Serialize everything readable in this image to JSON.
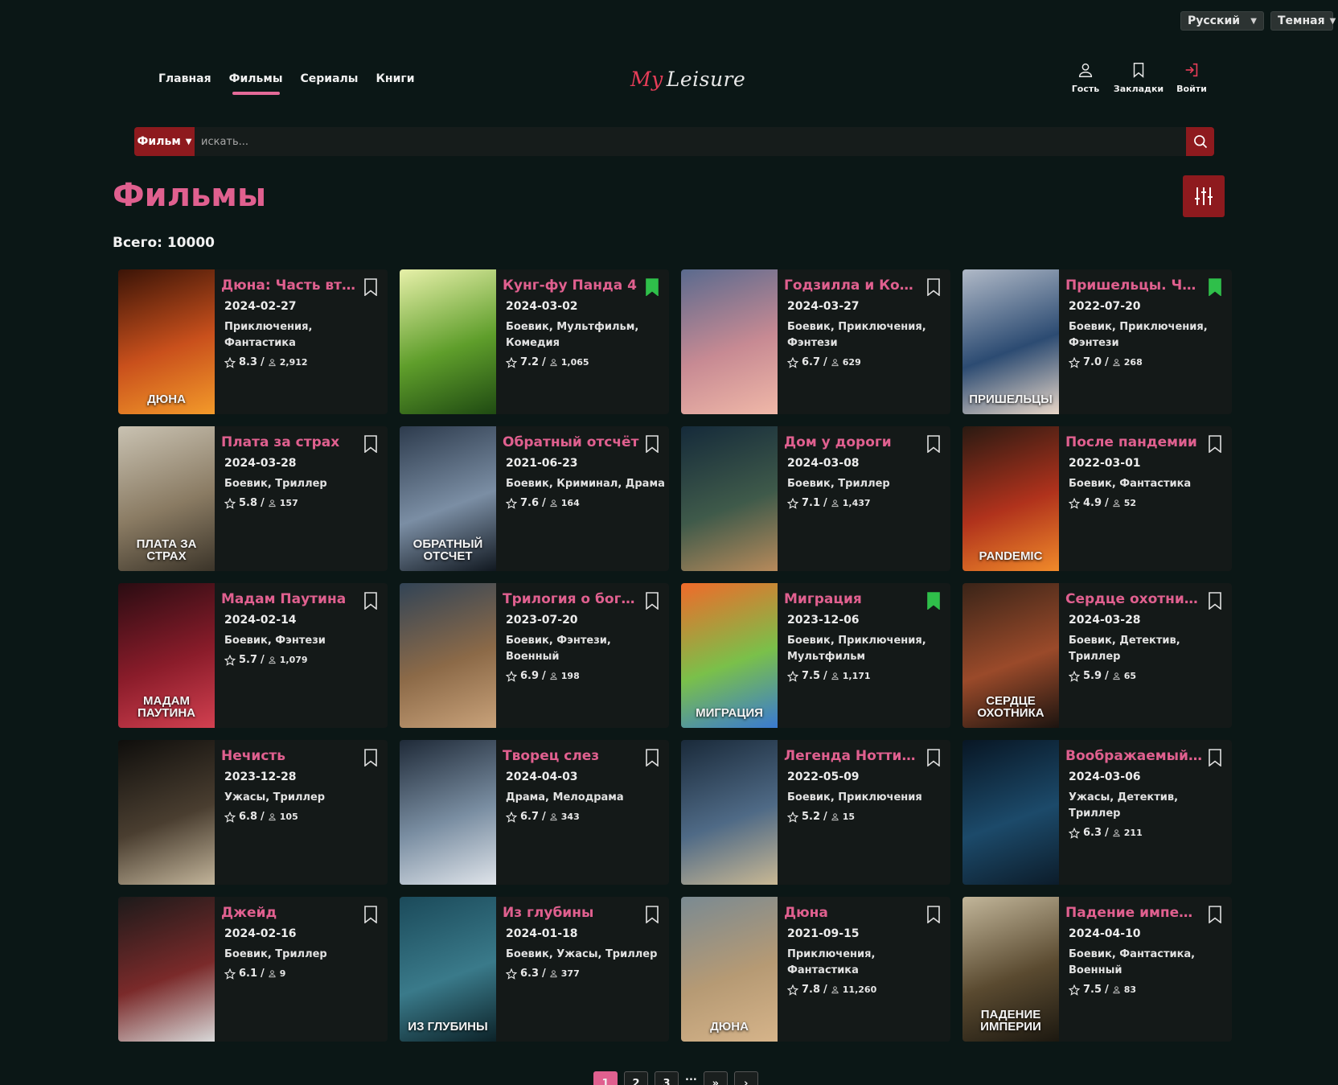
{
  "top": {
    "language": "Русский",
    "theme": "Темная"
  },
  "nav": [
    {
      "label": "Главная"
    },
    {
      "label": "Фильмы"
    },
    {
      "label": "Сериалы"
    },
    {
      "label": "Книги"
    }
  ],
  "logo": {
    "my": "My",
    "rest": "Leisure"
  },
  "user_actions": {
    "guest": "Гость",
    "bookmarks": "Закладки",
    "login": "Войти"
  },
  "search": {
    "type": "Фильм",
    "placeholder": "искать..."
  },
  "page": {
    "title": "Фильмы",
    "total": "Всего: 10000"
  },
  "colors": {
    "accent": "#e0608f",
    "button": "#8e1a1e",
    "bookmark_active": "#2fbf4a",
    "background": "#0b1716"
  },
  "movies": [
    {
      "title": "Дюна: Часть вто...",
      "date": "2024-02-27",
      "genres": "Приключения, Фантастика",
      "rating": "8.3",
      "votes": "2,912",
      "bookmarked": false,
      "poster_text": "ДЮНА",
      "poster_colors": [
        "#3b1407",
        "#c9501c",
        "#f39a2a"
      ]
    },
    {
      "title": "Кунг-фу Панда 4",
      "date": "2024-03-02",
      "genres": "Боевик, Мультфильм, Комедия",
      "rating": "7.2",
      "votes": "1,065",
      "bookmarked": true,
      "poster_text": "",
      "poster_colors": [
        "#e7f0a9",
        "#5f9e2b",
        "#1f4a12"
      ]
    },
    {
      "title": "Годзилла и Конг...",
      "date": "2024-03-27",
      "genres": "Боевик, Приключения, Фэнтези",
      "rating": "6.7",
      "votes": "629",
      "bookmarked": false,
      "poster_text": "",
      "poster_colors": [
        "#5a6a8e",
        "#c78a93",
        "#f0b8a8"
      ]
    },
    {
      "title": "Пришельцы. Ча...",
      "date": "2022-07-20",
      "genres": "Боевик, Приключения, Фэнтези",
      "rating": "7.0",
      "votes": "268",
      "bookmarked": true,
      "poster_text": "ПРИШЕЛЬЦЫ",
      "poster_colors": [
        "#b0b9c7",
        "#2c4b72",
        "#e8d7c8"
      ]
    },
    {
      "title": "Плата за страх",
      "date": "2024-03-28",
      "genres": "Боевик, Триллер",
      "rating": "5.8",
      "votes": "157",
      "bookmarked": false,
      "poster_text": "ПЛАТА ЗА СТРАХ",
      "poster_colors": [
        "#c9c2b2",
        "#8a7b63",
        "#3b3429"
      ]
    },
    {
      "title": "Обратный отсчёт",
      "date": "2021-06-23",
      "genres": "Боевик, Криминал, Драма",
      "rating": "7.6",
      "votes": "164",
      "bookmarked": false,
      "poster_text": "ОБРАТНЫЙ ОТСЧЕТ",
      "poster_colors": [
        "#2d3b4d",
        "#7b8ea4",
        "#111820"
      ]
    },
    {
      "title": "Дом у дороги",
      "date": "2024-03-08",
      "genres": "Боевик, Триллер",
      "rating": "7.1",
      "votes": "1,437",
      "bookmarked": false,
      "poster_text": "",
      "poster_colors": [
        "#152a3a",
        "#3f5a4a",
        "#b78a5b"
      ]
    },
    {
      "title": "После пандемии",
      "date": "2022-03-01",
      "genres": "Боевик, Фантастика",
      "rating": "4.9",
      "votes": "52",
      "bookmarked": false,
      "poster_text": "PANDEMIC",
      "poster_colors": [
        "#2a1a12",
        "#b0321c",
        "#f08a2a"
      ]
    },
    {
      "title": "Мадам Паутина",
      "date": "2024-02-14",
      "genres": "Боевик, Фэнтези",
      "rating": "5.7",
      "votes": "1,079",
      "bookmarked": false,
      "poster_text": "МАДАМ ПАУТИНА",
      "poster_colors": [
        "#2a0c12",
        "#8a1c2a",
        "#d24050"
      ]
    },
    {
      "title": "Трилогия о бога...",
      "date": "2023-07-20",
      "genres": "Боевик, Фэнтези, Военный",
      "rating": "6.9",
      "votes": "198",
      "bookmarked": false,
      "poster_text": "",
      "poster_colors": [
        "#324456",
        "#8c6a48",
        "#c9a27a"
      ]
    },
    {
      "title": "Миграция",
      "date": "2023-12-06",
      "genres": "Боевик, Приключения, Мультфильм",
      "rating": "7.5",
      "votes": "1,171",
      "bookmarked": true,
      "poster_text": "МИГРАЦИЯ",
      "poster_colors": [
        "#f06a2a",
        "#7ac04a",
        "#3a7ad2"
      ]
    },
    {
      "title": "Сердце охотника",
      "date": "2024-03-28",
      "genres": "Боевик, Детектив, Триллер",
      "rating": "5.9",
      "votes": "65",
      "bookmarked": false,
      "poster_text": "СЕРДЦЕ ОХОТНИКА",
      "poster_colors": [
        "#3a2418",
        "#9a4a2a",
        "#1c1410"
      ]
    },
    {
      "title": "Нечисть",
      "date": "2023-12-28",
      "genres": "Ужасы, Триллер",
      "rating": "6.8",
      "votes": "105",
      "bookmarked": false,
      "poster_text": "",
      "poster_colors": [
        "#0f0e0c",
        "#4a3e30",
        "#c2b49a"
      ]
    },
    {
      "title": "Творец слез",
      "date": "2024-04-03",
      "genres": "Драма, Мелодрама",
      "rating": "6.7",
      "votes": "343",
      "bookmarked": false,
      "poster_text": "",
      "poster_colors": [
        "#1f2a38",
        "#7a8ea2",
        "#dfe4ea"
      ]
    },
    {
      "title": "Легенда Ноттин...",
      "date": "2022-05-09",
      "genres": "Боевик, Приключения",
      "rating": "5.2",
      "votes": "15",
      "bookmarked": false,
      "poster_text": "",
      "poster_colors": [
        "#1a2a3a",
        "#4f6a86",
        "#c9b894"
      ]
    },
    {
      "title": "Воображаемый ...",
      "date": "2024-03-06",
      "genres": "Ужасы, Детектив, Триллер",
      "rating": "6.3",
      "votes": "211",
      "bookmarked": false,
      "poster_text": "",
      "poster_colors": [
        "#081624",
        "#1c4a6a",
        "#0c1c2a"
      ]
    },
    {
      "title": "Джейд",
      "date": "2024-02-16",
      "genres": "Боевик, Триллер",
      "rating": "6.1",
      "votes": "9",
      "bookmarked": false,
      "poster_text": "",
      "poster_colors": [
        "#1c1a1a",
        "#7a2a2a",
        "#d8d8d8"
      ]
    },
    {
      "title": "Из глубины",
      "date": "2024-01-18",
      "genres": "Боевик, Ужасы, Триллер",
      "rating": "6.3",
      "votes": "377",
      "bookmarked": false,
      "poster_text": "ИЗ ГЛУБИНЫ",
      "poster_colors": [
        "#1b4a5a",
        "#3a7a8a",
        "#0c2228"
      ]
    },
    {
      "title": "Дюна",
      "date": "2021-09-15",
      "genres": "Приключения, Фантастика",
      "rating": "7.8",
      "votes": "11,260",
      "bookmarked": false,
      "poster_text": "ДЮНА",
      "poster_colors": [
        "#7a8a92",
        "#b69a74",
        "#d6b48a"
      ]
    },
    {
      "title": "Падение импер...",
      "date": "2024-04-10",
      "genres": "Боевик, Фантастика, Военный",
      "rating": "7.5",
      "votes": "83",
      "bookmarked": false,
      "poster_text": "ПАДЕНИЕ ИМПЕРИИ",
      "poster_colors": [
        "#c2b69a",
        "#5a4a30",
        "#1c1810"
      ]
    }
  ],
  "pagination": {
    "pages": [
      "1",
      "2",
      "3"
    ],
    "dots": "...",
    "active": "1"
  }
}
